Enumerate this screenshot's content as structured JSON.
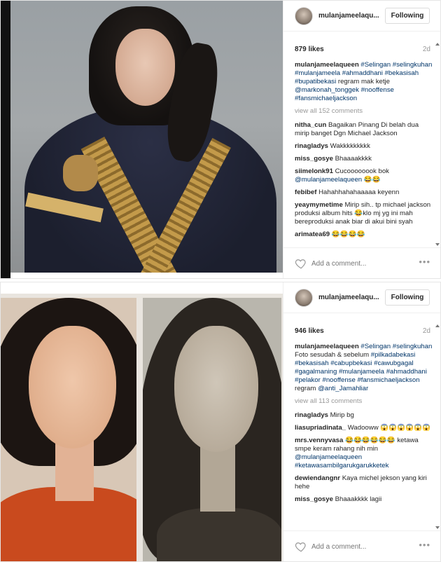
{
  "posts": [
    {
      "username": "mulanjameelaqu...",
      "follow_label": "Following",
      "likes": "879 likes",
      "age": "2d",
      "caption": {
        "user": "mulanjameelaqueen",
        "segments": [
          {
            "t": "#Selingan",
            "tag": true
          },
          {
            "t": " "
          },
          {
            "t": "#selingkuhan",
            "tag": true
          },
          {
            "t": " "
          },
          {
            "t": "#mulanjameela",
            "tag": true
          },
          {
            "t": " "
          },
          {
            "t": "#ahmaddhani",
            "tag": true
          },
          {
            "t": " "
          },
          {
            "t": "#bekasisah",
            "tag": true
          },
          {
            "t": " "
          },
          {
            "t": "#bupatibekasi",
            "tag": true
          },
          {
            "t": " regram mak ketje "
          },
          {
            "t": "@markonah_tonggek",
            "tag": true
          },
          {
            "t": " "
          },
          {
            "t": "#nooffense",
            "tag": true
          },
          {
            "t": " "
          },
          {
            "t": "#fansmichaeljackson",
            "tag": true
          }
        ]
      },
      "view_all": "view all 152 comments",
      "comments": [
        {
          "user": "nitha_cun",
          "segments": [
            {
              "t": "Bagaikan Pinang Di belah dua mirip banget Dgn Michael Jackson"
            }
          ]
        },
        {
          "user": "rinagladys",
          "segments": [
            {
              "t": "Wakkkkkkkkk"
            }
          ]
        },
        {
          "user": "miss_gosye",
          "segments": [
            {
              "t": "Bhaaaakkkk"
            }
          ]
        },
        {
          "user": "siimelonk91",
          "segments": [
            {
              "t": "Cucoooooook bok "
            },
            {
              "t": "@mulanjameelaqueen",
              "tag": true
            },
            {
              "t": " 😂😂"
            }
          ]
        },
        {
          "user": "febibef",
          "segments": [
            {
              "t": "Hahahhahahaaaaa keyenn"
            }
          ]
        },
        {
          "user": "yeaymymetime",
          "segments": [
            {
              "t": "Mirip sih.. tp michael jackson produksi album hits 😂klo mj yg ini mah bereproduksi anak biar di akui bini syah"
            }
          ]
        },
        {
          "user": "arimatea69",
          "segments": [
            {
              "t": "😂😂😂😂"
            }
          ]
        }
      ],
      "add_comment_placeholder": "Add a comment...",
      "more_label": "•••"
    },
    {
      "username": "mulanjameelaqu...",
      "follow_label": "Following",
      "likes": "946 likes",
      "age": "2d",
      "caption": {
        "user": "mulanjameelaqueen",
        "segments": [
          {
            "t": "#Selingan",
            "tag": true
          },
          {
            "t": " "
          },
          {
            "t": "#selingkuhan",
            "tag": true
          },
          {
            "t": " Foto sesudah & sebelum "
          },
          {
            "t": "#pilkadabekasi",
            "tag": true
          },
          {
            "t": " "
          },
          {
            "t": "#bekasisah",
            "tag": true
          },
          {
            "t": " "
          },
          {
            "t": "#cabupbekasi",
            "tag": true
          },
          {
            "t": " "
          },
          {
            "t": "#cawubgagal",
            "tag": true
          },
          {
            "t": " "
          },
          {
            "t": "#gagalmaning",
            "tag": true
          },
          {
            "t": " "
          },
          {
            "t": "#mulanjameela",
            "tag": true
          },
          {
            "t": " "
          },
          {
            "t": "#ahmaddhani",
            "tag": true
          },
          {
            "t": " "
          },
          {
            "t": "#pelakor",
            "tag": true
          },
          {
            "t": " "
          },
          {
            "t": "#nooffense",
            "tag": true
          },
          {
            "t": " "
          },
          {
            "t": "#fansmichaeljackson",
            "tag": true
          },
          {
            "t": " regram "
          },
          {
            "t": "@anti_Jamahliar",
            "tag": true
          }
        ]
      },
      "view_all": "view all 113 comments",
      "comments": [
        {
          "user": "rinagladys",
          "segments": [
            {
              "t": "Mirip bg"
            }
          ]
        },
        {
          "user": "liasupriadinata_",
          "segments": [
            {
              "t": "Wadooww 😱😱😱😱😱😱"
            }
          ]
        },
        {
          "user": "mrs.vennyvasa",
          "segments": [
            {
              "t": "😂😂😂😂😂😂 ketawa smpe keram rahang nih min "
            },
            {
              "t": "@mulanjameelaqueen",
              "tag": true
            },
            {
              "t": " "
            },
            {
              "t": "#ketawasambilgarukgarukketek",
              "tag": true
            }
          ]
        },
        {
          "user": "dewiendangnr",
          "segments": [
            {
              "t": "Kaya michel jekson yang kiri hehe"
            }
          ]
        },
        {
          "user": "miss_gosye",
          "segments": [
            {
              "t": "Bhaaakkkk lagii"
            }
          ]
        }
      ],
      "add_comment_placeholder": "Add a comment...",
      "more_label": "•••"
    }
  ]
}
